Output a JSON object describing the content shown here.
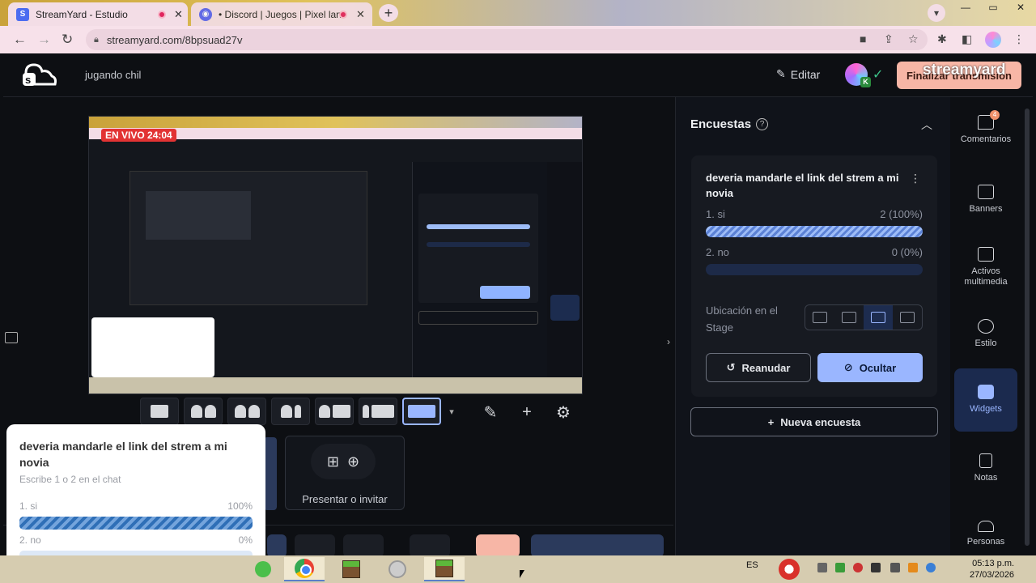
{
  "browser": {
    "tabs": [
      {
        "label": "StreamYard - Estudio",
        "icon": "streamyard-favicon"
      },
      {
        "label": "• Discord | Juegos | Pixel lan",
        "icon": "discord-favicon"
      }
    ],
    "url": "streamyard.com/8bpsuad27v"
  },
  "header": {
    "broadcast_title": "jugando chil",
    "edit_label": "Editar",
    "end_label": "Finalizar transmisión",
    "watermark": "streamyard",
    "avatar_badge": "K"
  },
  "stage": {
    "live_badge": "EN VIVO 24:04",
    "present_label": "Presentar o invitar"
  },
  "overlay_poll": {
    "question": "deveria mandarle el link del strem a mi novia",
    "hint": "Escribe 1 o 2 en el chat",
    "options": [
      {
        "label": "1. si",
        "pct": "100%",
        "fraction": 1.0
      },
      {
        "label": "2. no",
        "pct": "0%",
        "fraction": 0.0
      }
    ]
  },
  "panel": {
    "title": "Encuestas",
    "question": "deveria mandarle el link del strem a mi novia",
    "options": [
      {
        "label": "1. si",
        "value": "2 (100%)",
        "fraction": 1.0
      },
      {
        "label": "2. no",
        "value": "0 (0%)",
        "fraction": 0.0
      }
    ],
    "location_label": "Ubicación en el Stage",
    "resume_label": "Reanudar",
    "hide_label": "Ocultar",
    "new_poll_label": "Nueva encuesta"
  },
  "rail": [
    {
      "label": "Comentarios",
      "icon": "comment-icon",
      "badge": "4"
    },
    {
      "label": "Banners",
      "icon": "banner-icon"
    },
    {
      "label": "Activos multimedia",
      "icon": "media-icon"
    },
    {
      "label": "Estilo",
      "icon": "palette-icon"
    },
    {
      "label": "Widgets",
      "icon": "widgets-icon",
      "selected": true
    },
    {
      "label": "Notas",
      "icon": "notes-icon"
    },
    {
      "label": "Personas",
      "icon": "people-icon"
    }
  ],
  "taskbar": {
    "language": "ES",
    "time": "05:13 p.m.",
    "date": "27/03/2026"
  },
  "colors": {
    "accent": "#9ab6ff",
    "end_button": "#f7b6a6",
    "live": "#e23333",
    "background": "#0d0f13"
  }
}
